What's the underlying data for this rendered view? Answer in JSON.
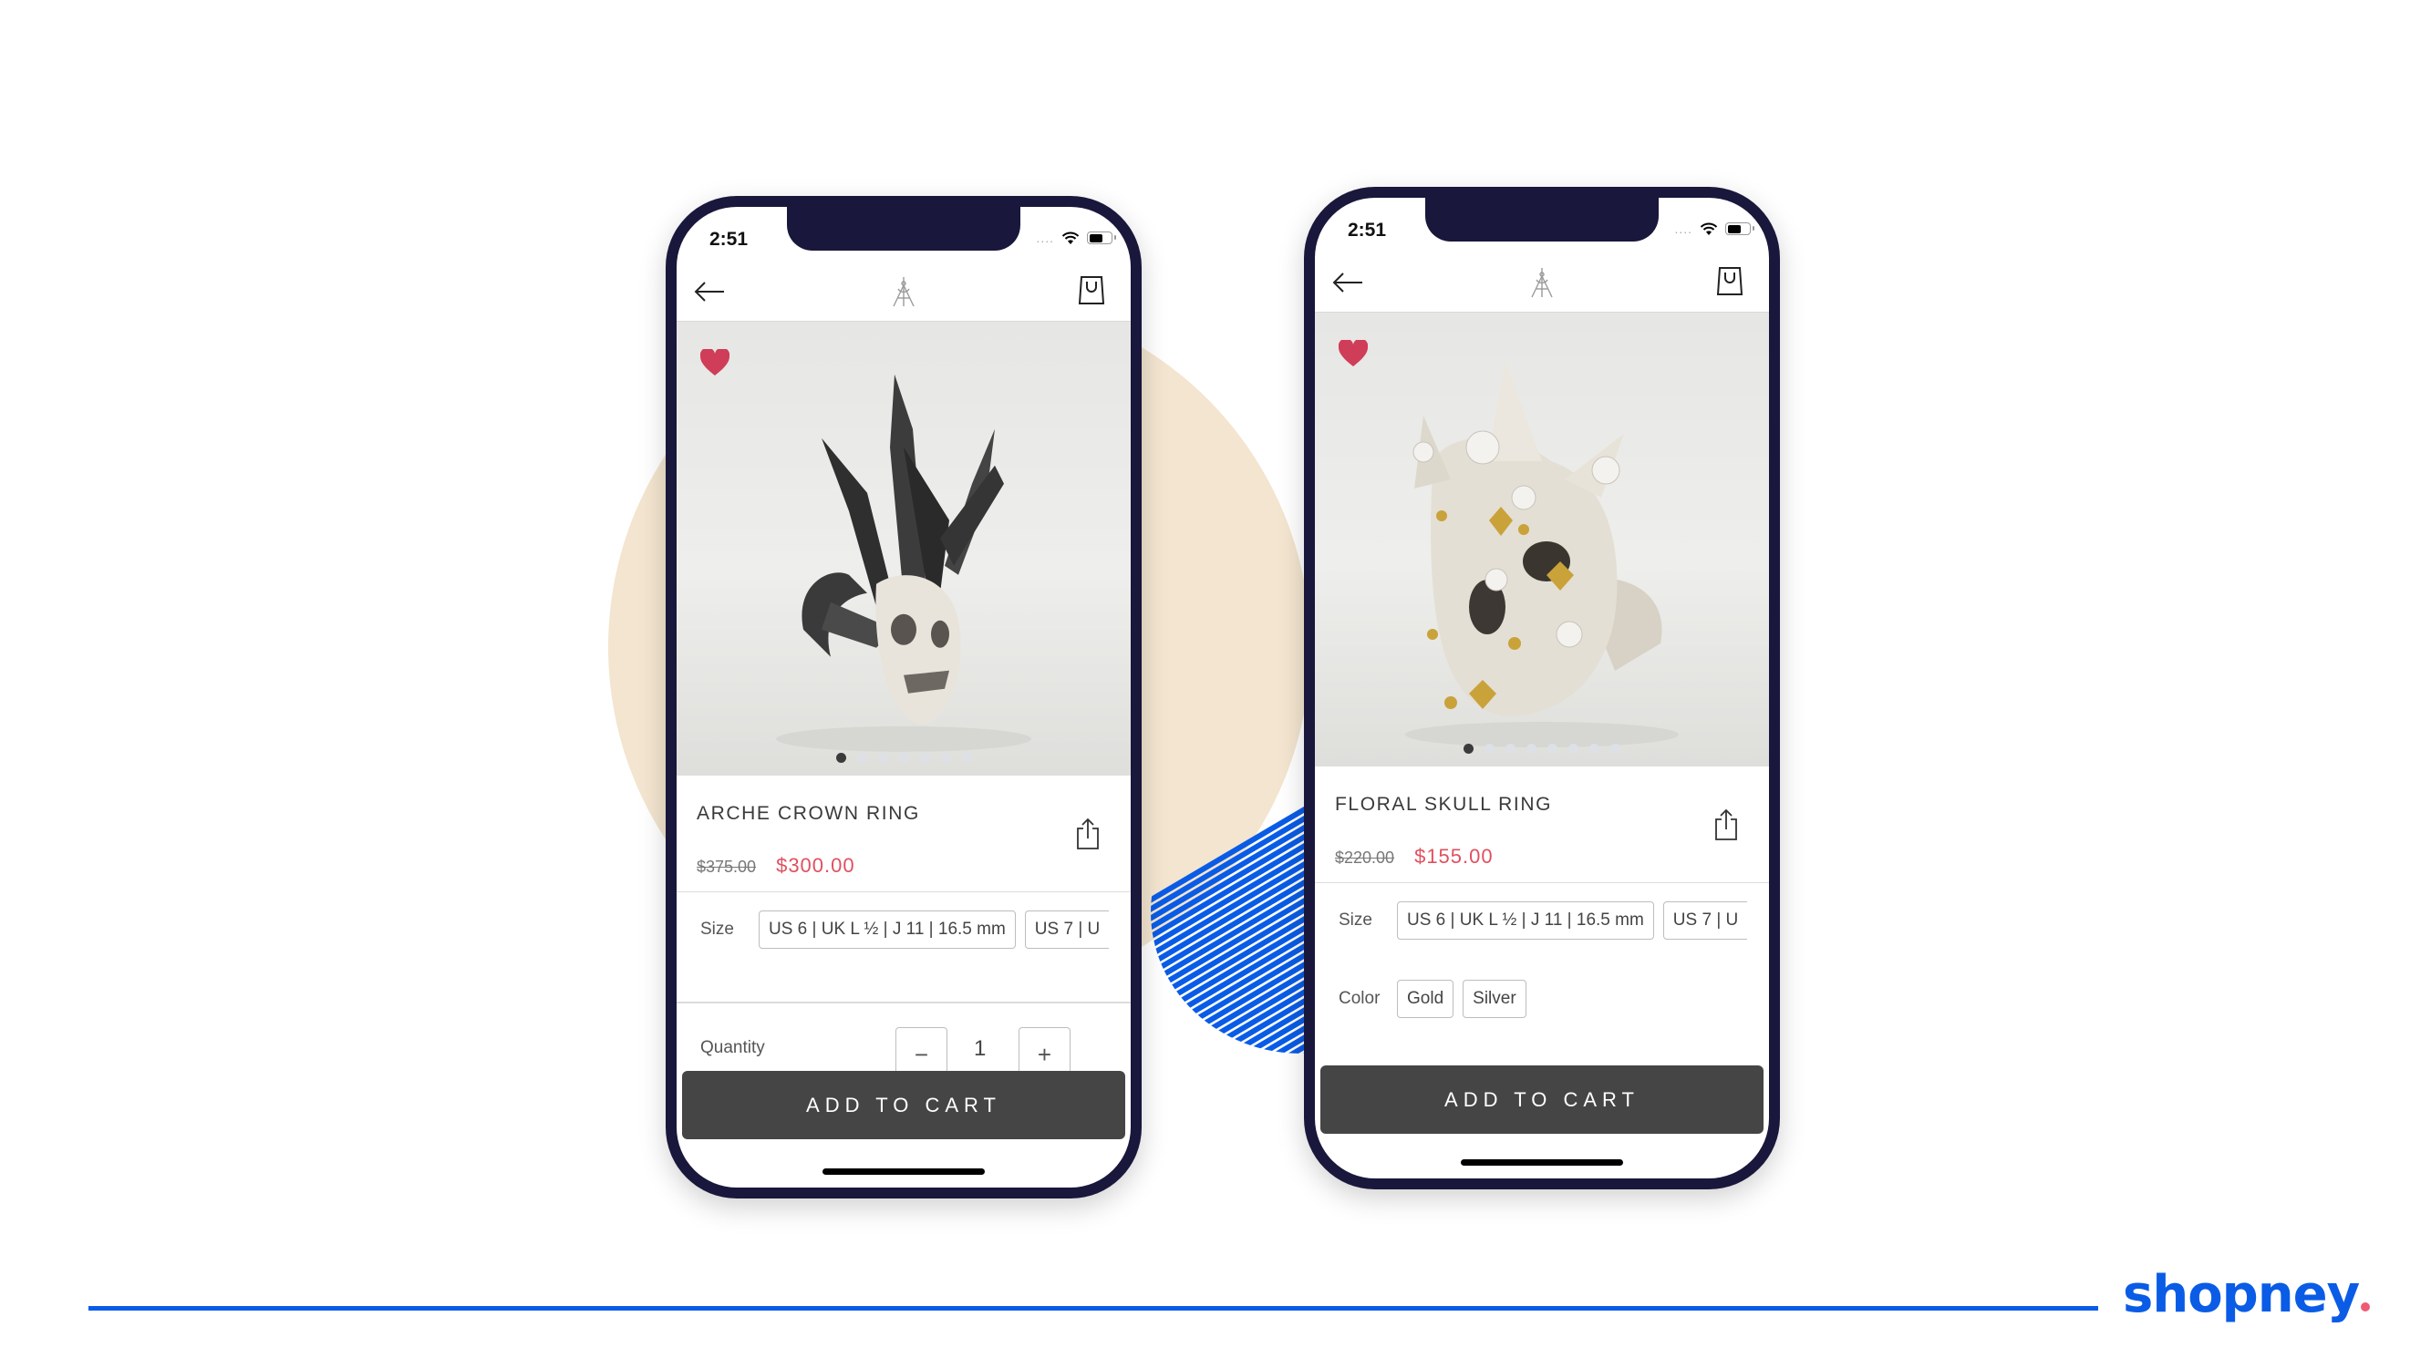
{
  "colors": {
    "brand_blue": "#0a5ce6",
    "accent_pink": "#ef5b72",
    "sale_price_red": "#e0505f",
    "phone_frame": "#19173b",
    "beige_circle": "#f3e5cf",
    "cart_button": "#454545",
    "heart": "#cf3d58"
  },
  "brand": {
    "logo_text": "shopney",
    "logo_dot": "."
  },
  "phones": [
    {
      "status": {
        "time": "2:51",
        "signal": "....",
        "wifi_icon": "wifi-icon",
        "battery_icon": "battery-icon"
      },
      "nav": {
        "back_icon": "arrow-left-icon",
        "logo_icon": "brand-logo-icon",
        "cart_icon": "shopping-bag-icon"
      },
      "product": {
        "image_description": "Arche crown ring – dark silver crown spikes over carved white skull",
        "favorite_icon": "heart-icon",
        "carousel": {
          "total": 7,
          "active": 1
        },
        "title": "ARCHE CROWN RING",
        "old_price": "$375.00",
        "sale_price": "$300.00",
        "share_icon": "share-icon"
      },
      "options": {
        "size_label": "Size",
        "sizes": [
          "US 6 | UK L ½ | J 11 | 16.5 mm",
          "US 7 | U"
        ]
      },
      "quantity": {
        "label": "Quantity",
        "minus": "−",
        "value": "1",
        "plus": "+"
      },
      "add_to_cart": "ADD TO CART"
    },
    {
      "status": {
        "time": "2:51",
        "signal": "....",
        "wifi_icon": "wifi-icon",
        "battery_icon": "battery-icon"
      },
      "nav": {
        "back_icon": "arrow-left-icon",
        "logo_icon": "brand-logo-icon",
        "cart_icon": "shopping-bag-icon"
      },
      "product": {
        "image_description": "Floral skull ring – ivory skull with pearls and gold studs",
        "favorite_icon": "heart-icon",
        "carousel": {
          "total": 8,
          "active": 1
        },
        "title": "FLORAL SKULL RING",
        "old_price": "$220.00",
        "sale_price": "$155.00",
        "share_icon": "share-icon"
      },
      "options": {
        "size_label": "Size",
        "sizes": [
          "US 6 | UK L ½ | J 11 | 16.5 mm",
          "US 7 | U"
        ],
        "color_label": "Color",
        "colors": [
          "Gold",
          "Silver"
        ]
      },
      "add_to_cart": "ADD TO CART"
    }
  ]
}
